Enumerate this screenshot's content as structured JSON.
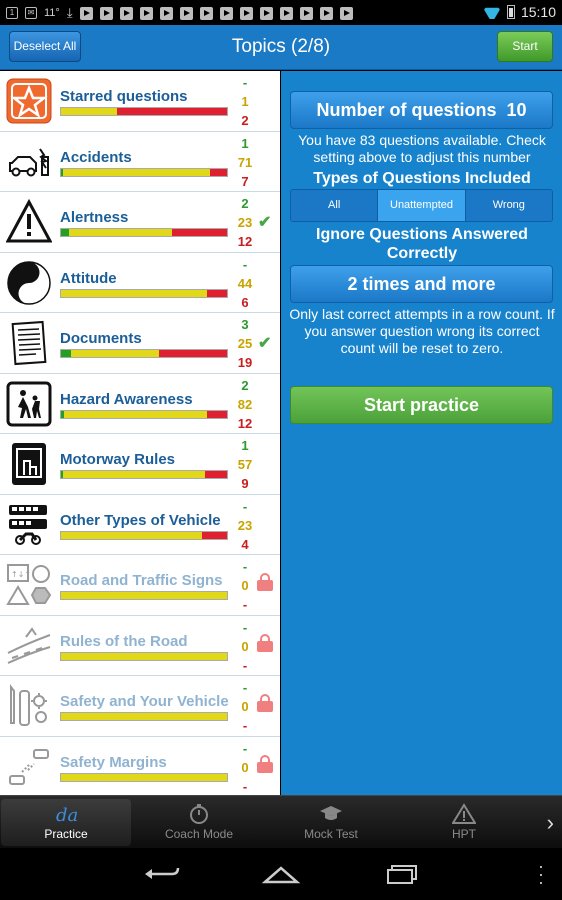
{
  "status_bar": {
    "left_icons": [
      "notification-1",
      "mail",
      "11°",
      "download",
      "play",
      "play",
      "play",
      "play",
      "play",
      "play",
      "play",
      "play",
      "play",
      "play",
      "play",
      "play",
      "play",
      "play"
    ],
    "signal_label": "11°",
    "time": "15:10"
  },
  "action_bar": {
    "deselect_label": "Deselect All",
    "title": "Topics (2/8)",
    "start_label": "Start"
  },
  "topics": [
    {
      "name": "Starred questions",
      "icon": "star-icon",
      "correct": "-",
      "pending": "1",
      "wrong": "2",
      "bar": {
        "green": 0,
        "yellow": 0.34,
        "red": 0.66
      },
      "mark": "none"
    },
    {
      "name": "Accidents",
      "icon": "car-crash-icon",
      "correct": "1",
      "pending": "71",
      "wrong": "7",
      "bar": {
        "green": 0.01,
        "yellow": 0.89,
        "red": 0.1
      },
      "mark": "none"
    },
    {
      "name": "Alertness",
      "icon": "warning-sign-icon",
      "correct": "2",
      "pending": "23",
      "wrong": "12",
      "bar": {
        "green": 0.05,
        "yellow": 0.62,
        "red": 0.33
      },
      "mark": "check"
    },
    {
      "name": "Attitude",
      "icon": "yin-yang-icon",
      "correct": "-",
      "pending": "44",
      "wrong": "6",
      "bar": {
        "green": 0,
        "yellow": 0.88,
        "red": 0.12
      },
      "mark": "none"
    },
    {
      "name": "Documents",
      "icon": "document-icon",
      "correct": "3",
      "pending": "25",
      "wrong": "19",
      "bar": {
        "green": 0.06,
        "yellow": 0.53,
        "red": 0.41
      },
      "mark": "check"
    },
    {
      "name": "Hazard Awareness",
      "icon": "pedestrians-sign-icon",
      "correct": "2",
      "pending": "82",
      "wrong": "12",
      "bar": {
        "green": 0.02,
        "yellow": 0.86,
        "red": 0.12
      },
      "mark": "none"
    },
    {
      "name": "Motorway Rules",
      "icon": "motorway-sign-icon",
      "correct": "1",
      "pending": "57",
      "wrong": "9",
      "bar": {
        "green": 0.01,
        "yellow": 0.86,
        "red": 0.13
      },
      "mark": "none"
    },
    {
      "name": "Other Types of Vehicle",
      "icon": "vehicles-icon",
      "correct": "-",
      "pending": "23",
      "wrong": "4",
      "bar": {
        "green": 0,
        "yellow": 0.85,
        "red": 0.15
      },
      "mark": "none"
    },
    {
      "name": "Road and Traffic Signs",
      "icon": "traffic-signs-icon",
      "correct": "-",
      "pending": "0",
      "wrong": "-",
      "bar": {
        "green": 0,
        "yellow": 1,
        "red": 0
      },
      "mark": "lock"
    },
    {
      "name": "Rules of the Road",
      "icon": "road-icon",
      "correct": "-",
      "pending": "0",
      "wrong": "-",
      "bar": {
        "green": 0,
        "yellow": 1,
        "red": 0
      },
      "mark": "lock"
    },
    {
      "name": "Safety and Your Vehicle",
      "icon": "tools-icon",
      "correct": "-",
      "pending": "0",
      "wrong": "-",
      "bar": {
        "green": 0,
        "yellow": 1,
        "red": 0
      },
      "mark": "lock"
    },
    {
      "name": "Safety Margins",
      "icon": "cars-distance-icon",
      "correct": "-",
      "pending": "0",
      "wrong": "-",
      "bar": {
        "green": 0,
        "yellow": 1,
        "red": 0
      },
      "mark": "lock"
    }
  ],
  "panel": {
    "num_questions_label": "Number of questions",
    "num_questions_value": "10",
    "available_text": "You have 83 questions available. Check setting above to adjust this number",
    "types_heading": "Types of Questions Included",
    "types": [
      "All",
      "Unattempted",
      "Wrong"
    ],
    "types_selected": "Unattempted",
    "ignore_heading": "Ignore Questions Answered Correctly",
    "ignore_value": "2 times and more",
    "ignore_note": "Only last correct attempts in a row count. If you answer question wrong its correct count will be reset to zero.",
    "start_practice_label": "Start practice"
  },
  "tabs": [
    {
      "label": "Practice",
      "icon": "practice-icon",
      "active": true
    },
    {
      "label": "Coach Mode",
      "icon": "stopwatch-icon",
      "active": false
    },
    {
      "label": "Mock Test",
      "icon": "graduation-cap-icon",
      "active": false
    },
    {
      "label": "HPT",
      "icon": "hazard-triangle-icon",
      "active": false
    }
  ],
  "colors": {
    "accent_blue": "#1883cd",
    "action_bar": "#1b7ac6",
    "green_button": "#5bb043",
    "topic_name": "#1b5e98",
    "correct": "#2d9a2d",
    "pending": "#c9a400",
    "wrong": "#c81e1e"
  }
}
